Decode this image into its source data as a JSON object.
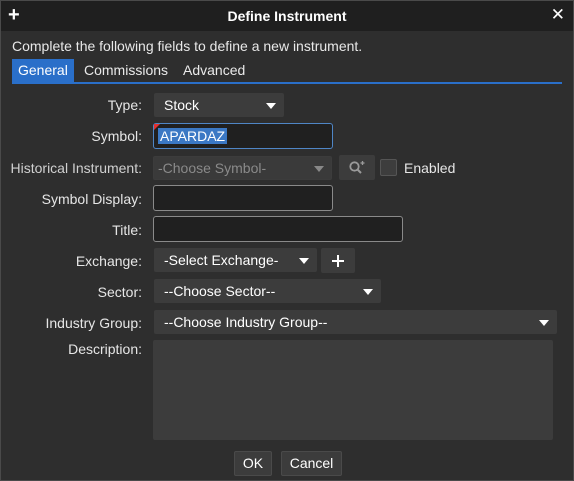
{
  "window": {
    "title": "Define Instrument"
  },
  "intro": "Complete the following fields to define a new instrument.",
  "tabs": [
    {
      "label": "General",
      "active": true
    },
    {
      "label": "Commissions",
      "active": false
    },
    {
      "label": "Advanced",
      "active": false
    }
  ],
  "form": {
    "type": {
      "label": "Type:",
      "value": "Stock"
    },
    "symbol": {
      "label": "Symbol:",
      "value": "APARDAZ"
    },
    "historical": {
      "label": "Historical Instrument:",
      "value": "-Choose Symbol-",
      "enabled_label": "Enabled"
    },
    "symbol_display": {
      "label": "Symbol Display:",
      "value": ""
    },
    "title": {
      "label": "Title:",
      "value": ""
    },
    "exchange": {
      "label": "Exchange:",
      "value": "-Select Exchange-"
    },
    "sector": {
      "label": "Sector:",
      "value": "--Choose Sector--"
    },
    "industry_group": {
      "label": "Industry Group:",
      "value": "--Choose Industry Group--"
    },
    "description": {
      "label": "Description:",
      "value": ""
    }
  },
  "buttons": {
    "ok": "OK",
    "cancel": "Cancel"
  },
  "colors": {
    "accent": "#2a6fc9",
    "background": "#2e2e2e",
    "titlebar": "#1f1f1f"
  }
}
